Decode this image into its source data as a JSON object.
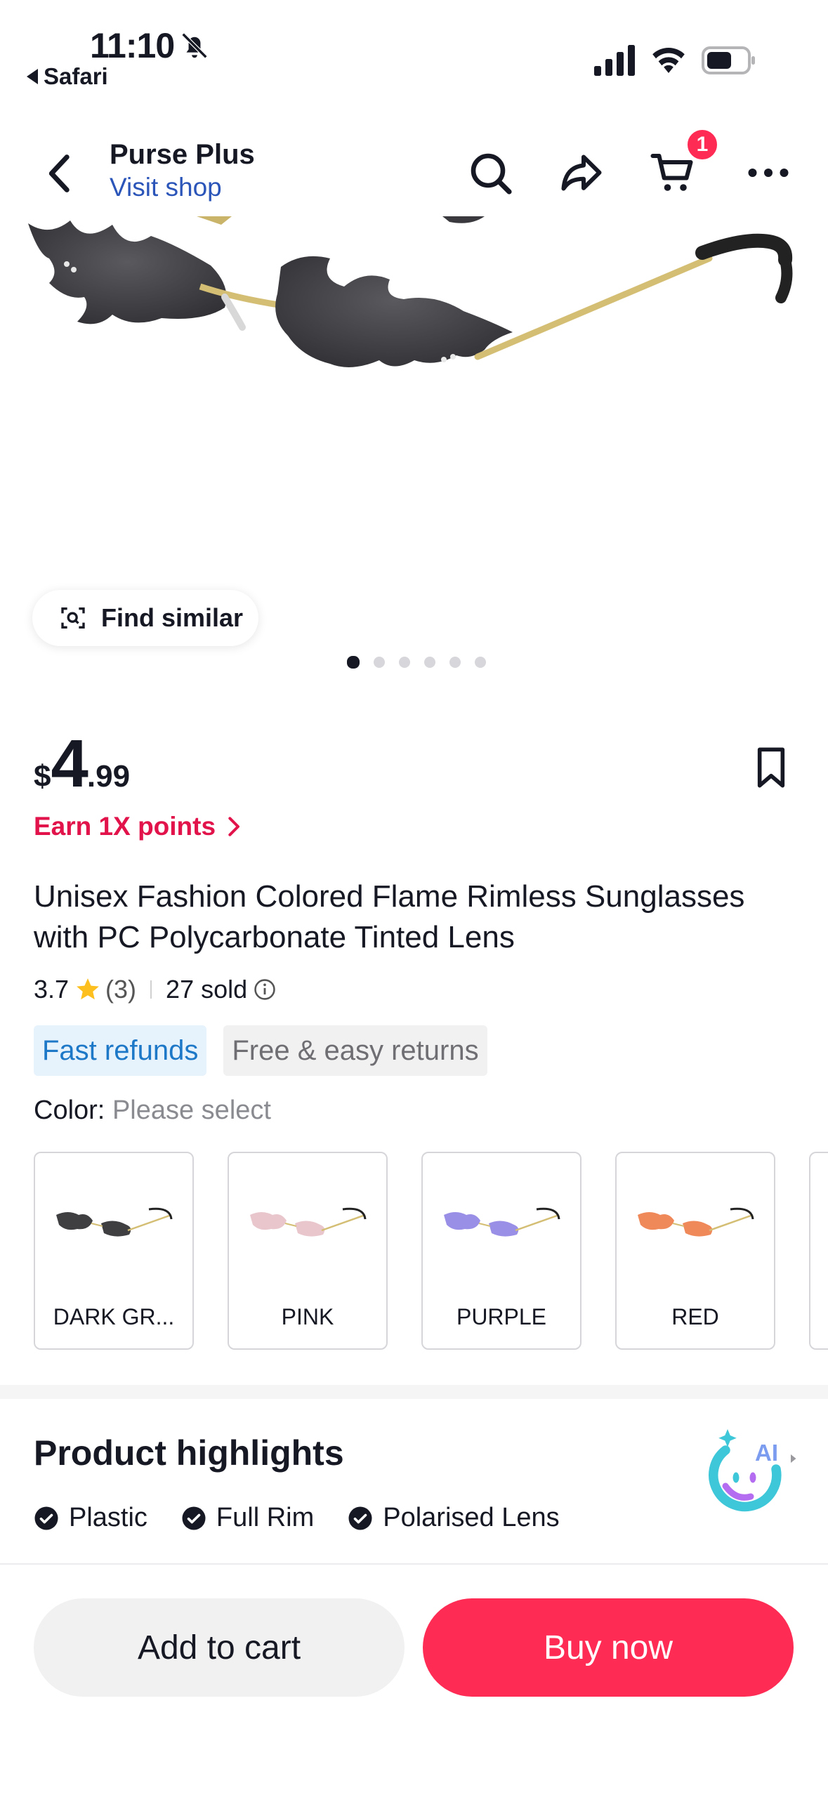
{
  "status_bar": {
    "time": "11:10",
    "back_app": "Safari"
  },
  "header": {
    "shop_name": "Purse Plus",
    "visit_shop": "Visit shop",
    "cart_count": "1"
  },
  "gallery": {
    "find_similar": "Find similar",
    "dot_count": 6,
    "active_dot": 1
  },
  "price": {
    "currency": "$",
    "integer": "4",
    "decimal": ".99"
  },
  "earn_points": "Earn 1X points",
  "product": {
    "title": "Unisex Fashion Colored Flame Rimless Sunglasses with PC Polycarbonate Tinted Lens",
    "rating": "3.7",
    "rating_count": "(3)",
    "sold": "27 sold"
  },
  "badges": {
    "fast_refunds": "Fast refunds",
    "returns": "Free & easy returns"
  },
  "color": {
    "label": "Color:",
    "value": "Please select",
    "options": [
      {
        "label": "DARK GR...",
        "lens": "#3f3f42"
      },
      {
        "label": "PINK",
        "lens": "#e8c6cc"
      },
      {
        "label": "PURPLE",
        "lens": "#9a8fe6"
      },
      {
        "label": "RED",
        "lens": "#f0895a"
      }
    ]
  },
  "highlights": {
    "title": "Product highlights",
    "items": [
      "Plastic",
      "Full Rim",
      "Polarised Lens"
    ]
  },
  "actions": {
    "add_to_cart": "Add to cart",
    "buy_now": "Buy now"
  },
  "colors": {
    "accent": "#fe2c55",
    "link": "#2b55b8",
    "points": "#e1134a",
    "star": "#fcbf1e"
  }
}
